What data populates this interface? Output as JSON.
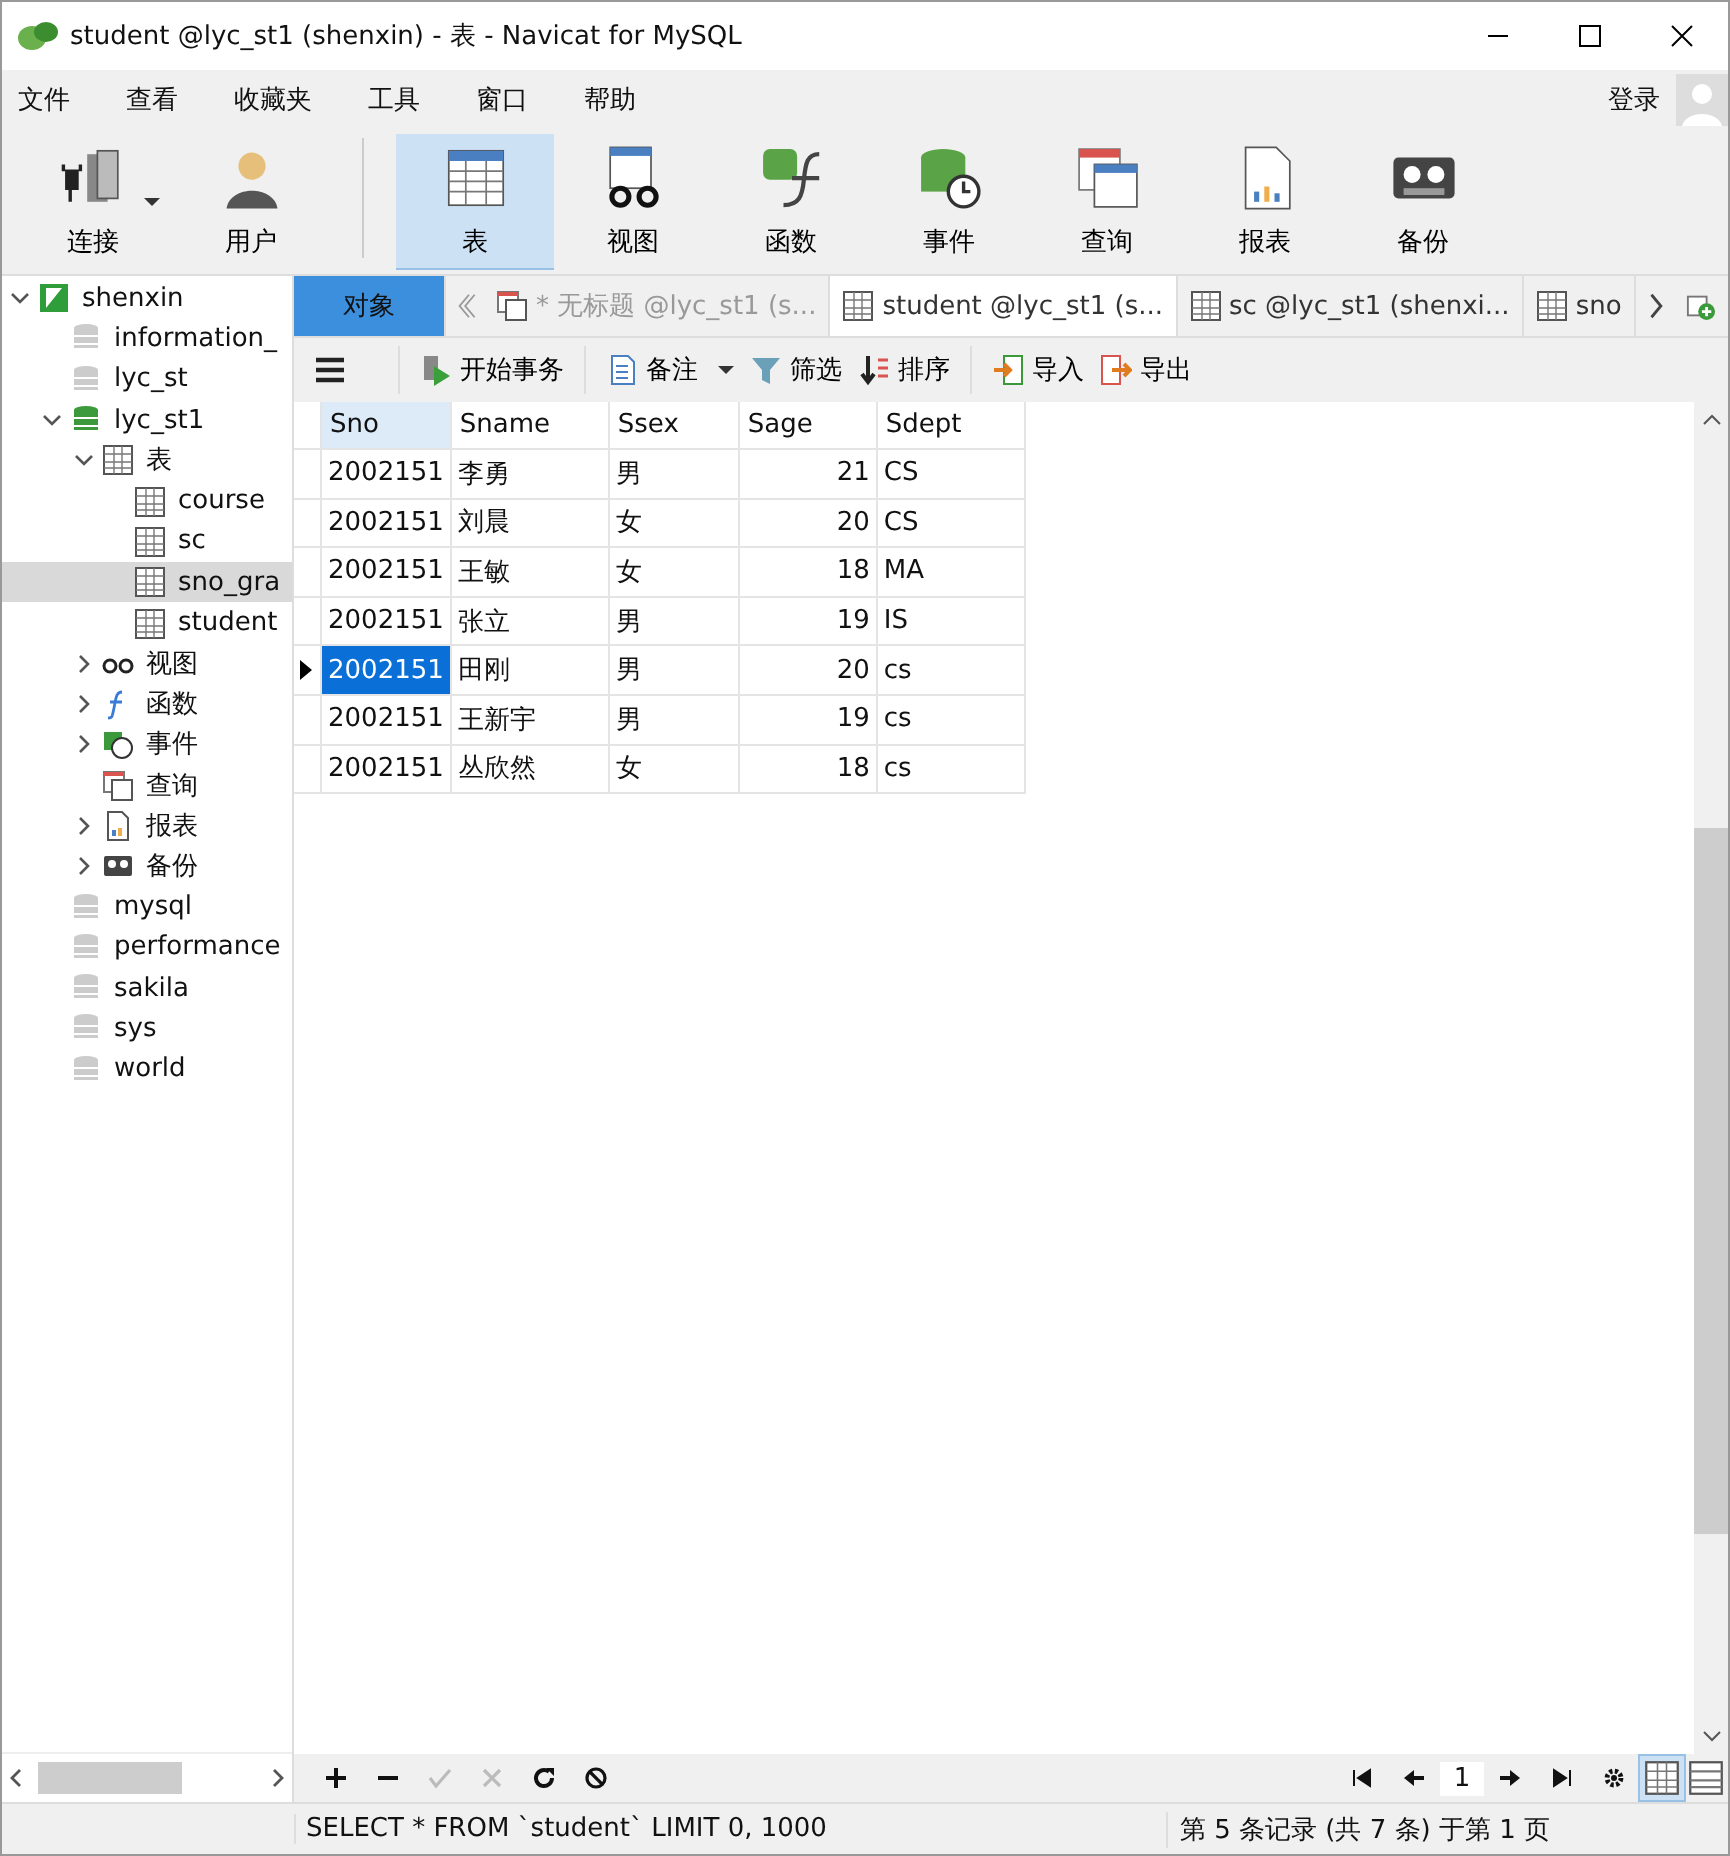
{
  "window": {
    "title": "student @lyc_st1 (shenxin) - 表 - Navicat for MySQL"
  },
  "menu": [
    "文件",
    "查看",
    "收藏夹",
    "工具",
    "窗口",
    "帮助"
  ],
  "login": "登录",
  "toolbar": [
    {
      "label": "连接",
      "kind": "connect",
      "selected": false
    },
    {
      "label": "用户",
      "kind": "user",
      "selected": false
    },
    {
      "label": "表",
      "kind": "table",
      "selected": true
    },
    {
      "label": "视图",
      "kind": "view",
      "selected": false
    },
    {
      "label": "函数",
      "kind": "function",
      "selected": false
    },
    {
      "label": "事件",
      "kind": "event",
      "selected": false
    },
    {
      "label": "查询",
      "kind": "query",
      "selected": false
    },
    {
      "label": "报表",
      "kind": "report",
      "selected": false
    },
    {
      "label": "备份",
      "kind": "backup",
      "selected": false
    }
  ],
  "tree": [
    {
      "label": "shenxin",
      "kind": "server",
      "expanded": true,
      "selected": false,
      "children": [
        {
          "label": "information_",
          "kind": "db",
          "selected": false
        },
        {
          "label": "lyc_st",
          "kind": "db",
          "selected": false
        },
        {
          "label": "lyc_st1",
          "kind": "dbopen",
          "expanded": true,
          "selected": false,
          "children": [
            {
              "label": "表",
              "kind": "table",
              "expanded": true,
              "selected": false,
              "children": [
                {
                  "label": "course",
                  "kind": "table",
                  "selected": false
                },
                {
                  "label": "sc",
                  "kind": "table",
                  "selected": false
                },
                {
                  "label": "sno_gra",
                  "kind": "table",
                  "selected": true
                },
                {
                  "label": "student",
                  "kind": "table",
                  "selected": false
                }
              ]
            },
            {
              "label": "视图",
              "kind": "view",
              "expanded": false,
              "selected": false
            },
            {
              "label": "函数",
              "kind": "function",
              "expanded": false,
              "selected": false
            },
            {
              "label": "事件",
              "kind": "event",
              "expanded": false,
              "selected": false
            },
            {
              "label": "查询",
              "kind": "query",
              "selected": false
            },
            {
              "label": "报表",
              "kind": "report",
              "expanded": false,
              "selected": false
            },
            {
              "label": "备份",
              "kind": "backup",
              "expanded": false,
              "selected": false
            }
          ]
        },
        {
          "label": "mysql",
          "kind": "db",
          "selected": false
        },
        {
          "label": "performance",
          "kind": "db",
          "selected": false
        },
        {
          "label": "sakila",
          "kind": "db",
          "selected": false
        },
        {
          "label": "sys",
          "kind": "db",
          "selected": false
        },
        {
          "label": "world",
          "kind": "db",
          "selected": false
        }
      ]
    }
  ],
  "tabs": [
    {
      "label": "对象",
      "kind": "objects",
      "selected": false
    },
    {
      "label": "* 无标题 @lyc_st1 (s...",
      "kind": "query",
      "selected": false
    },
    {
      "label": "student @lyc_st1 (s...",
      "kind": "table",
      "selected": true
    },
    {
      "label": "sc @lyc_st1 (shenxi...",
      "kind": "table",
      "selected": false
    },
    {
      "label": "sno",
      "kind": "table",
      "selected": false
    }
  ],
  "grid_toolbar": [
    {
      "label": "开始事务",
      "kind": "transaction"
    },
    {
      "label": "备注",
      "kind": "note"
    },
    {
      "label": "筛选",
      "kind": "filter"
    },
    {
      "label": "排序",
      "kind": "sort"
    },
    {
      "label": "导入",
      "kind": "import"
    },
    {
      "label": "导出",
      "kind": "export"
    }
  ],
  "table": {
    "columns": [
      "Sno",
      "Sname",
      "Ssex",
      "Sage",
      "Sdept"
    ],
    "rows": [
      {
        "cells": [
          "2002151",
          "李勇",
          "男",
          "21",
          "CS"
        ],
        "selected": false
      },
      {
        "cells": [
          "2002151",
          "刘晨",
          "女",
          "20",
          "CS"
        ],
        "selected": false
      },
      {
        "cells": [
          "2002151",
          "王敏",
          "女",
          "18",
          "MA"
        ],
        "selected": false
      },
      {
        "cells": [
          "2002151",
          "张立",
          "男",
          "19",
          "IS"
        ],
        "selected": false
      },
      {
        "cells": [
          "2002151",
          "田刚",
          "男",
          "20",
          "cs"
        ],
        "selected": true
      },
      {
        "cells": [
          "2002151",
          "王新宇",
          "男",
          "19",
          "cs"
        ],
        "selected": false
      },
      {
        "cells": [
          "2002151",
          "丛欣然",
          "女",
          "18",
          "cs"
        ],
        "selected": false
      }
    ]
  },
  "pager": {
    "page": "1"
  },
  "status_bar": {
    "sql": "SELECT * FROM `student` LIMIT 0, 1000",
    "records": "第 5 条记录 (共 7 条) 于第 1 页"
  }
}
